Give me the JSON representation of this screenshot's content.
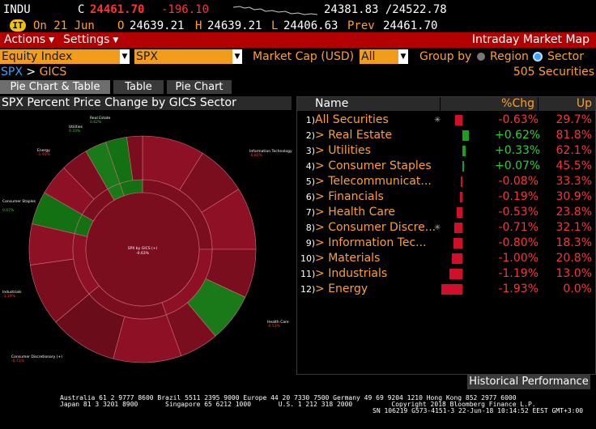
{
  "ticker": {
    "symbol": "INDU",
    "c_label": "C",
    "last": "24461.70",
    "change": "-196.10",
    "range": "24381.83 /24522.78",
    "date_label": "On 21 Jun",
    "open_label": "O",
    "open": "24639.21",
    "high_label": "H",
    "high": "24639.21",
    "low_label": "L",
    "low": "24406.63",
    "prev_label": "Prev",
    "prev": "24461.70"
  },
  "menu": {
    "actions": "Actions",
    "settings": "Settings",
    "title": "Intraday Market Map"
  },
  "controls": {
    "universe": "Equity Index",
    "index": "SPX",
    "size_label": "Market Cap (USD)",
    "size_value": "All",
    "group_by": "Group by",
    "opt_region": "Region",
    "opt_sector": "Sector"
  },
  "breadcrumb": {
    "root": "SPX",
    "sep": ">",
    "leaf": "GICS",
    "count": "505 Securities"
  },
  "tabs": [
    "Pie Chart & Table",
    "Table",
    "Pie Chart"
  ],
  "chart": {
    "title": "SPX Percent Price Change by GICS Sector",
    "center_line1": "SPX by GICS (+)",
    "center_line2": "-0.63%",
    "labels": {
      "real_estate": "Real Estate",
      "real_estate_v": "0.62%",
      "utilities": "Utilities",
      "utilities_v": "0.33%",
      "energy": "Energy",
      "energy_v": "-1.93%",
      "info_tech": "Information Technology",
      "info_tech_v": "-0.80%",
      "cons_staples": "Consumer Staples",
      "cons_staples_v": "0.07%",
      "industrials": "Industrials",
      "industrials_v": "-1.19%",
      "health_care": "Health Care",
      "health_care_v": "-0.53%",
      "cons_disc": "Consumer Discretionary (+)",
      "cons_disc_v": "-0.71%"
    }
  },
  "table": {
    "headers": {
      "name": "Name",
      "chg": "%Chg",
      "up": "Up"
    },
    "rows": [
      {
        "idx": "1)",
        "name": "All Securities",
        "chg": "-0.63%",
        "up": "29.7%",
        "v": -0.63,
        "expand": false,
        "star": true
      },
      {
        "idx": "2)",
        "name": "Real Estate",
        "chg": "+0.62%",
        "up": "81.8%",
        "v": 0.62,
        "expand": true,
        "star": false
      },
      {
        "idx": "3)",
        "name": "Utilities",
        "chg": "+0.33%",
        "up": "62.1%",
        "v": 0.33,
        "expand": true,
        "star": false
      },
      {
        "idx": "4)",
        "name": "Consumer Staples",
        "chg": "+0.07%",
        "up": "45.5%",
        "v": 0.07,
        "expand": true,
        "star": false
      },
      {
        "idx": "5)",
        "name": "Telecommunicat...",
        "chg": "-0.08%",
        "up": "33.3%",
        "v": -0.08,
        "expand": true,
        "star": false
      },
      {
        "idx": "6)",
        "name": "Financials",
        "chg": "-0.19%",
        "up": "30.9%",
        "v": -0.19,
        "expand": true,
        "star": false
      },
      {
        "idx": "7)",
        "name": "Health Care",
        "chg": "-0.53%",
        "up": "23.8%",
        "v": -0.53,
        "expand": true,
        "star": false
      },
      {
        "idx": "8)",
        "name": "Consumer Discre...",
        "chg": "-0.71%",
        "up": "32.1%",
        "v": -0.71,
        "expand": true,
        "star": true
      },
      {
        "idx": "9)",
        "name": "Information Tec...",
        "chg": "-0.80%",
        "up": "18.3%",
        "v": -0.8,
        "expand": true,
        "star": false
      },
      {
        "idx": "10)",
        "name": "Materials",
        "chg": "-1.00%",
        "up": "20.8%",
        "v": -1.0,
        "expand": true,
        "star": false
      },
      {
        "idx": "11)",
        "name": "Industrials",
        "chg": "-1.19%",
        "up": "13.0%",
        "v": -1.19,
        "expand": true,
        "star": false
      },
      {
        "idx": "12)",
        "name": "Energy",
        "chg": "-1.93%",
        "up": "0.0%",
        "v": -1.93,
        "expand": true,
        "star": false
      }
    ]
  },
  "historical_button": "Historical Performance",
  "footer": {
    "line1": "Australia 61 2 9777 8600 Brazil 5511 2395 9000 Europe 44 20 7330 7500 Germany 49 69 9204 1210 Hong Kong 852 2977 6000",
    "line2": "Japan 81 3 3201 8900       Singapore 65 6212 1000       U.S. 1 212 318 2000          Copyright 2018 Bloomberg Finance L.P.",
    "line3": "SN 106219 G573-4151-3 22-Jun-18 10:14:52 EEST GMT+3:00"
  },
  "colors": {
    "pos_strong": "#1a8f1a",
    "neg_strong": "#c00000",
    "menu_red": "#b30000",
    "amber": "#f29c1b"
  }
}
